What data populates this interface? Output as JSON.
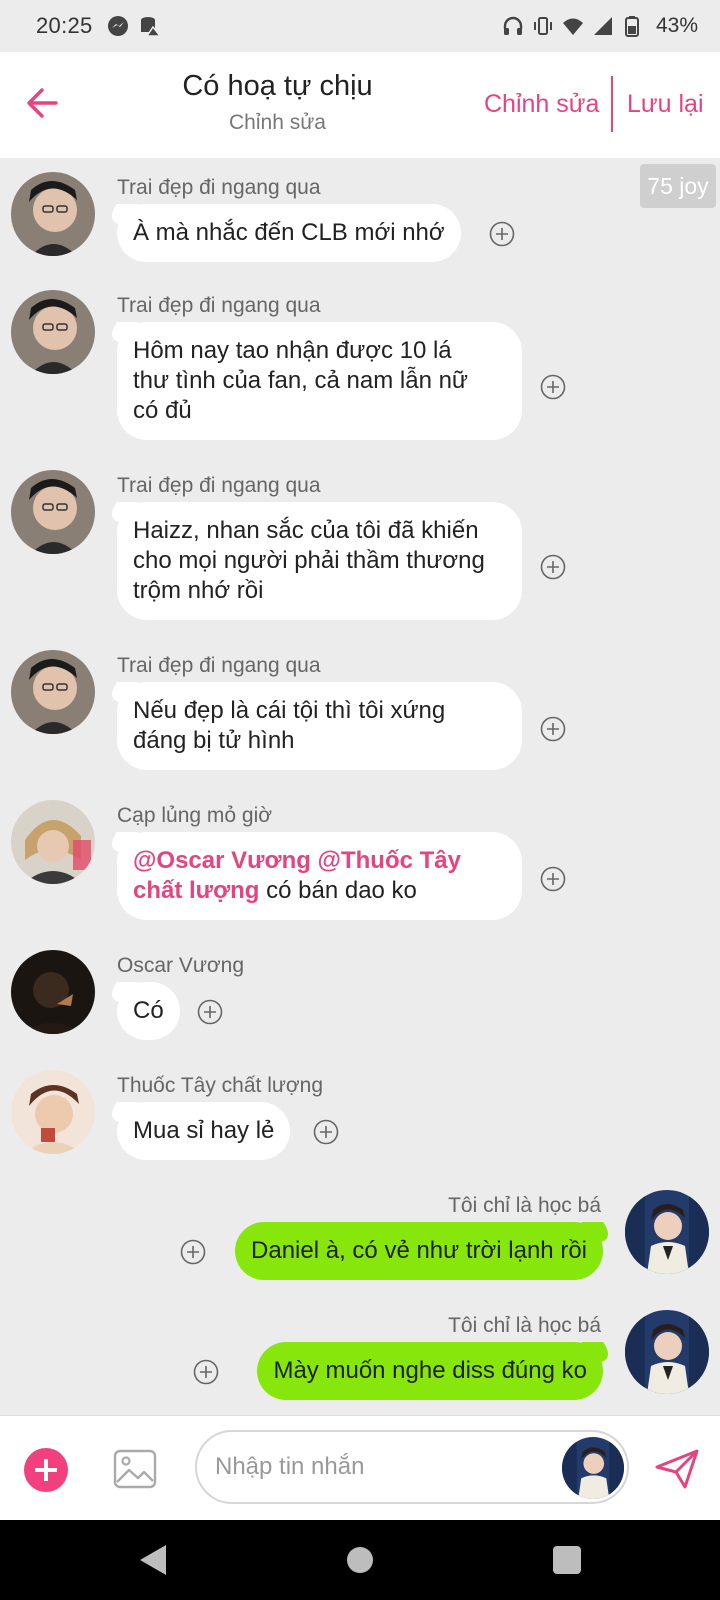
{
  "status_bar": {
    "time": "20:25",
    "battery": "43%",
    "icons": [
      "messenger-icon",
      "database-alert-icon",
      "headphones-icon",
      "vibrate-icon",
      "wifi-icon",
      "signal-icon",
      "battery-icon"
    ]
  },
  "header": {
    "title": "Có hoạ tự chịu",
    "subtitle": "Chỉnh sửa",
    "edit_label": "Chỉnh sửa",
    "save_label": "Lưu lại",
    "accent_color": "#e6437f"
  },
  "chat": {
    "joy_badge": "75 joy",
    "messages": [
      {
        "sender": "Trai đẹp đi ngang qua",
        "lines": [
          "À mà nhắc đến CLB mới nhớ"
        ],
        "side": "left"
      },
      {
        "sender": "Trai đẹp đi ngang qua",
        "lines": [
          "Hôm nay tao nhận được 10 lá",
          "thư tình của fan, cả nam lẫn nữ",
          "có đủ"
        ],
        "side": "left"
      },
      {
        "sender": "Trai đẹp đi ngang qua",
        "lines": [
          "Haizz, nhan sắc của tôi đã khiến",
          "cho mọi người phải thầm thương",
          "trộm nhớ rồi"
        ],
        "side": "left"
      },
      {
        "sender": "Trai đẹp đi ngang qua",
        "lines": [
          "Nếu đẹp là cái tội thì tôi xứng",
          "đáng bị tử hình"
        ],
        "side": "left"
      },
      {
        "sender": "Cạp lủng mỏ giờ",
        "mention_line1": "@Oscar Vương @Thuốc Tây",
        "mention_line2": "chất lượng",
        "rest_line2": " có bán dao ko",
        "side": "left"
      },
      {
        "sender": "Oscar Vương",
        "lines": [
          "Có"
        ],
        "side": "left"
      },
      {
        "sender": "Thuốc Tây chất lượng",
        "lines": [
          "Mua sỉ hay lẻ"
        ],
        "side": "left"
      },
      {
        "sender": "Tôi chỉ là học bá",
        "lines": [
          "Daniel à, có vẻ như trời lạnh rồi"
        ],
        "side": "right"
      },
      {
        "sender": "Tôi chỉ là học bá",
        "lines": [
          "Mày muốn nghe diss đúng ko"
        ],
        "side": "right"
      }
    ]
  },
  "input_bar": {
    "placeholder": "Nhập tin nhắn",
    "add_color": "#f23f7e",
    "send_color": "#e6437f"
  },
  "bubble_colors": {
    "incoming": "#ffffff",
    "outgoing": "#87e60c"
  }
}
